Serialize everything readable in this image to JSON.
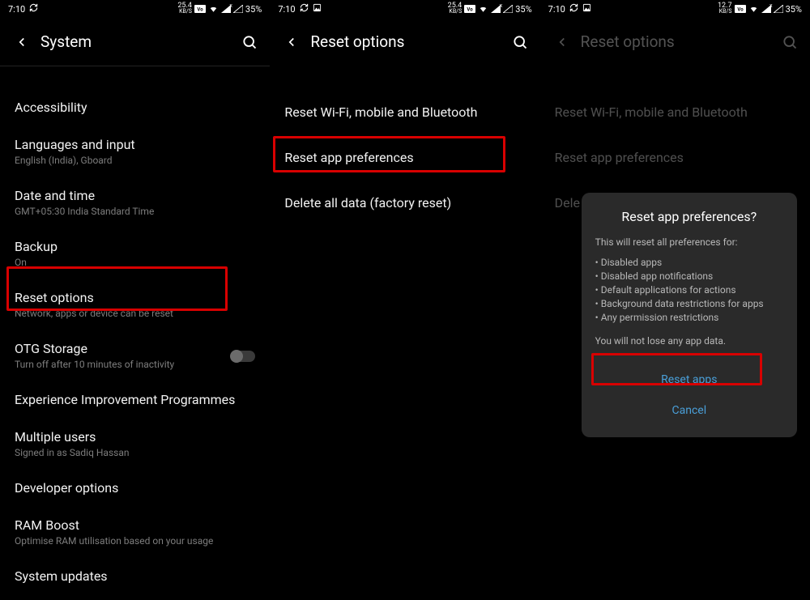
{
  "status": {
    "time": "7:10",
    "kbs12": "25.4",
    "kbs3": "12.7",
    "kbs_unit": "KB/S",
    "battery": "35%"
  },
  "screen1": {
    "title": "System",
    "items": [
      {
        "primary": "Accessibility",
        "secondary": ""
      },
      {
        "primary": "Languages and input",
        "secondary": "English (India), Gboard"
      },
      {
        "primary": "Date and time",
        "secondary": "GMT+05:30 India Standard Time"
      },
      {
        "primary": "Backup",
        "secondary": "On"
      },
      {
        "primary": "Reset options",
        "secondary": "Network, apps or device can be reset"
      },
      {
        "primary": "OTG Storage",
        "secondary": "Turn off after 10 minutes of inactivity"
      },
      {
        "primary": "Experience Improvement Programmes",
        "secondary": ""
      },
      {
        "primary": "Multiple users",
        "secondary": "Signed in as Sadiq Hassan"
      },
      {
        "primary": "Developer options",
        "secondary": ""
      },
      {
        "primary": "RAM Boost",
        "secondary": "Optimise RAM utilisation based on your usage"
      },
      {
        "primary": "System updates",
        "secondary": ""
      }
    ]
  },
  "screen2": {
    "title": "Reset options",
    "items": [
      "Reset Wi-Fi, mobile and Bluetooth",
      "Reset app preferences",
      "Delete all data (factory reset)"
    ]
  },
  "screen3": {
    "title": "Reset options",
    "items": [
      "Reset Wi-Fi, mobile and Bluetooth",
      "Reset app preferences",
      "Delete all data (factory reset)"
    ],
    "item2_truncated": "Dele",
    "dialog": {
      "title": "Reset app preferences?",
      "intro": "This will reset all preferences for:",
      "bullets": [
        "Disabled apps",
        "Disabled app notifications",
        "Default applications for actions",
        "Background data restrictions for apps",
        "Any permission restrictions"
      ],
      "outro": "You will not lose any app data.",
      "reset": "Reset apps",
      "cancel": "Cancel"
    }
  }
}
